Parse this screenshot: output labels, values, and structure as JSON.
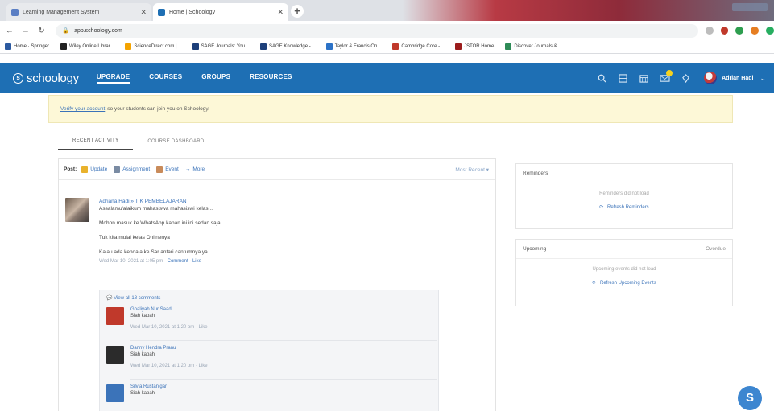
{
  "browser": {
    "tabs": [
      {
        "title": "Learning Management System",
        "color": "#5b7fc4"
      },
      {
        "title": "Home | Schoology",
        "color": "#1e6fb4"
      }
    ],
    "new_tab_label": "+",
    "url": "app.schoology.com",
    "bookmarks": [
      {
        "label": "Home · Springer",
        "color": "#2c5aa0"
      },
      {
        "label": "Wiley Online Librar...",
        "color": "#222222"
      },
      {
        "label": "ScienceDirect.com |...",
        "color": "#f4a300"
      },
      {
        "label": "SAGE Journals: You...",
        "color": "#1d3f7a"
      },
      {
        "label": "SAGE Knowledge -...",
        "color": "#1d3f7a"
      },
      {
        "label": "Taylor & Francis On...",
        "color": "#2c72c7"
      },
      {
        "label": "Cambridge Core -...",
        "color": "#c0392b"
      },
      {
        "label": "JSTOR Home",
        "color": "#9b1c1c"
      },
      {
        "label": "Discover Journals &...",
        "color": "#2e8b57"
      }
    ]
  },
  "header": {
    "logo_text": "schoology",
    "nav": [
      "UPGRADE",
      "COURSES",
      "GROUPS",
      "RESOURCES"
    ],
    "user_name": "Adrian Hadi",
    "icons": [
      "search-icon",
      "apps-icon",
      "calendar-icon",
      "messages-icon",
      "notifications-icon"
    ]
  },
  "banner": {
    "link_text": "Verify your account",
    "text": "so your students can join you on Schoology."
  },
  "tabs": [
    "RECENT ACTIVITY",
    "COURSE DASHBOARD"
  ],
  "postbar": {
    "label": "Post:",
    "options": [
      "Update",
      "Assignment",
      "Event",
      "More"
    ],
    "sort": "Most Recent"
  },
  "post": {
    "author": "Adriana Hadi » TIK PEMBELAJARAN",
    "lines": [
      "Assalamu'alaikum mahasiswa mahasiswi kelas...",
      "Mohon masuk ke WhatsApp kapan ini ini sedan saja...",
      "Tuk kita mulai kelas Onlinenya",
      "Kalau ada kendala ke Sar antari cantumnya ya"
    ],
    "meta": "Wed Mar 10, 2021 at 1:05 pm",
    "meta_links": "· Comment · Like"
  },
  "comments": {
    "view_all": "View all 18 comments",
    "items": [
      {
        "name": "Ghaliyah Nur Saadi",
        "text": "Siah kapah",
        "meta": "Wed Mar 10, 2021 at 1:20 pm · Like",
        "color": "#c0392b"
      },
      {
        "name": "Danny Hendra Pranu",
        "text": "Siah kapah",
        "meta": "Wed Mar 10, 2021 at 1:20 pm · Like",
        "color": "#2b2b2b"
      },
      {
        "name": "Silvia Rustanigar",
        "text": "Siah kapah",
        "meta": "",
        "color": "#3b73b9"
      }
    ]
  },
  "reminders": {
    "title": "Reminders",
    "empty": "Reminders did not load",
    "refresh": "Refresh Reminders"
  },
  "upcoming": {
    "title": "Upcoming",
    "link": "Overdue",
    "empty": "Upcoming events did not load",
    "refresh": "Refresh Upcoming Events"
  },
  "fab_label": "S"
}
